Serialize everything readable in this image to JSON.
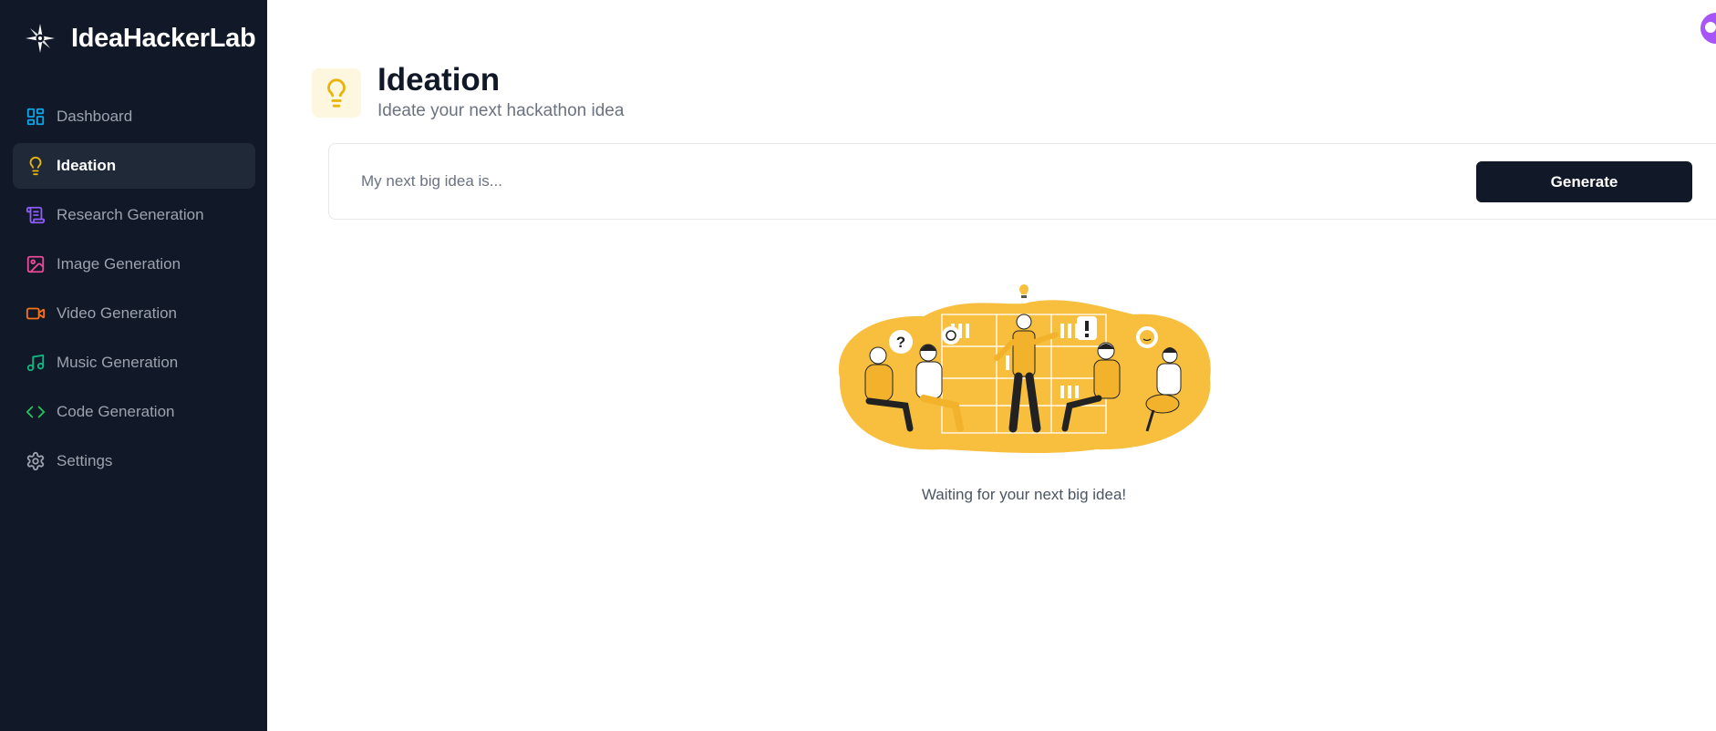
{
  "app": {
    "name": "IdeaHackerLab",
    "logo_icon": "sparkle-compass-icon"
  },
  "sidebar": {
    "items": [
      {
        "label": "Dashboard",
        "icon": "layout-grid-icon",
        "color": "#0ea5e9",
        "active": false
      },
      {
        "label": "Ideation",
        "icon": "lightbulb-icon",
        "color": "#eab308",
        "active": true
      },
      {
        "label": "Research Generation",
        "icon": "scroll-text-icon",
        "color": "#8b5cf6",
        "active": false
      },
      {
        "label": "Image Generation",
        "icon": "image-icon",
        "color": "#ec4899",
        "active": false
      },
      {
        "label": "Video Generation",
        "icon": "video-camera-icon",
        "color": "#f97316",
        "active": false
      },
      {
        "label": "Music Generation",
        "icon": "music-note-icon",
        "color": "#10b981",
        "active": false
      },
      {
        "label": "Code Generation",
        "icon": "code-brackets-icon",
        "color": "#22c55e",
        "active": false
      },
      {
        "label": "Settings",
        "icon": "gear-icon",
        "color": "#9ca3af",
        "active": false
      }
    ]
  },
  "header": {
    "title": "Ideation",
    "subtitle": "Ideate your next hackathon idea",
    "icon": "lightbulb-icon",
    "icon_color": "#eab308"
  },
  "form": {
    "input_value": "",
    "placeholder": "My next big idea is...",
    "generate_label": "Generate"
  },
  "empty_state": {
    "illustration": "team-brainstorm-illustration",
    "message": "Waiting for your next big idea!"
  },
  "colors": {
    "sidebar_bg": "#111827",
    "accent_yellow": "#f7bf3d",
    "avatar": "#a855f7"
  }
}
